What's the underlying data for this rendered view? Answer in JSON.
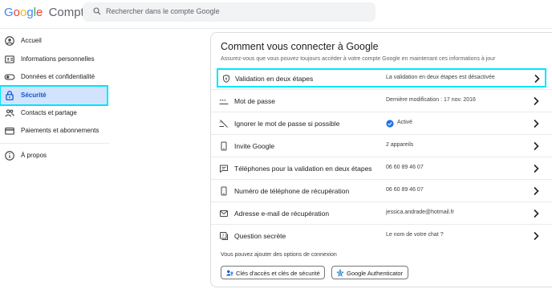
{
  "header": {
    "logo_letters": [
      "G",
      "o",
      "o",
      "g",
      "l",
      "e"
    ],
    "logo_suffix": "Compte",
    "search_placeholder": "Rechercher dans le compte Google"
  },
  "sidebar": {
    "items": [
      {
        "label": "Accueil",
        "icon": "account-circle-icon"
      },
      {
        "label": "Informations personnelles",
        "icon": "id-card-icon"
      },
      {
        "label": "Données et confidentialité",
        "icon": "toggle-icon"
      },
      {
        "label": "Sécurité",
        "icon": "lock-icon",
        "active": true
      },
      {
        "label": "Contacts et partage",
        "icon": "people-icon"
      },
      {
        "label": "Paiements et abonnements",
        "icon": "credit-card-icon"
      },
      {
        "label": "À propos",
        "icon": "info-icon"
      }
    ]
  },
  "main": {
    "title": "Comment vous connecter à Google",
    "subtitle": "Assurez-vous que vous pouvez toujours accéder à votre compte Google en maintenant ces informations à jour",
    "rows": [
      {
        "label": "Validation en deux étapes",
        "value": "La validation en deux étapes est désactivée",
        "icon": "shield-icon"
      },
      {
        "label": "Mot de passe",
        "value": "Dernière modification : 17 nov. 2016",
        "icon": "password-icon"
      },
      {
        "label": "Ignorer le mot de passe si possible",
        "value": "Activé",
        "icon": "skip-password-icon"
      },
      {
        "label": "Invite Google",
        "value": "2 appareils",
        "icon": "phone-icon"
      },
      {
        "label": "Téléphones pour la validation en deux étapes",
        "value": "06 60 89 46 07",
        "icon": "message-icon"
      },
      {
        "label": "Numéro de téléphone de récupération",
        "value": "06 60 89 46 07",
        "icon": "phone-icon"
      },
      {
        "label": "Adresse e-mail de récupération",
        "value": "jessica.andrade@hotmail.fr",
        "icon": "mail-icon"
      },
      {
        "label": "Question secrète",
        "value": "Le nom de votre chat ?",
        "icon": "question-icon"
      }
    ],
    "more_options_text": "Vous pouvez ajouter des options de connexion",
    "chips": [
      {
        "label": "Clés d'accès et clés de sécurité",
        "icon": "passkey-icon"
      },
      {
        "label": "Google Authenticator",
        "icon": "authenticator-icon"
      }
    ]
  },
  "colors": {
    "accent": "#0b57d0",
    "active_bg": "#d3e3fd",
    "highlight": "#00e5ff",
    "check": "#1a73e8"
  }
}
